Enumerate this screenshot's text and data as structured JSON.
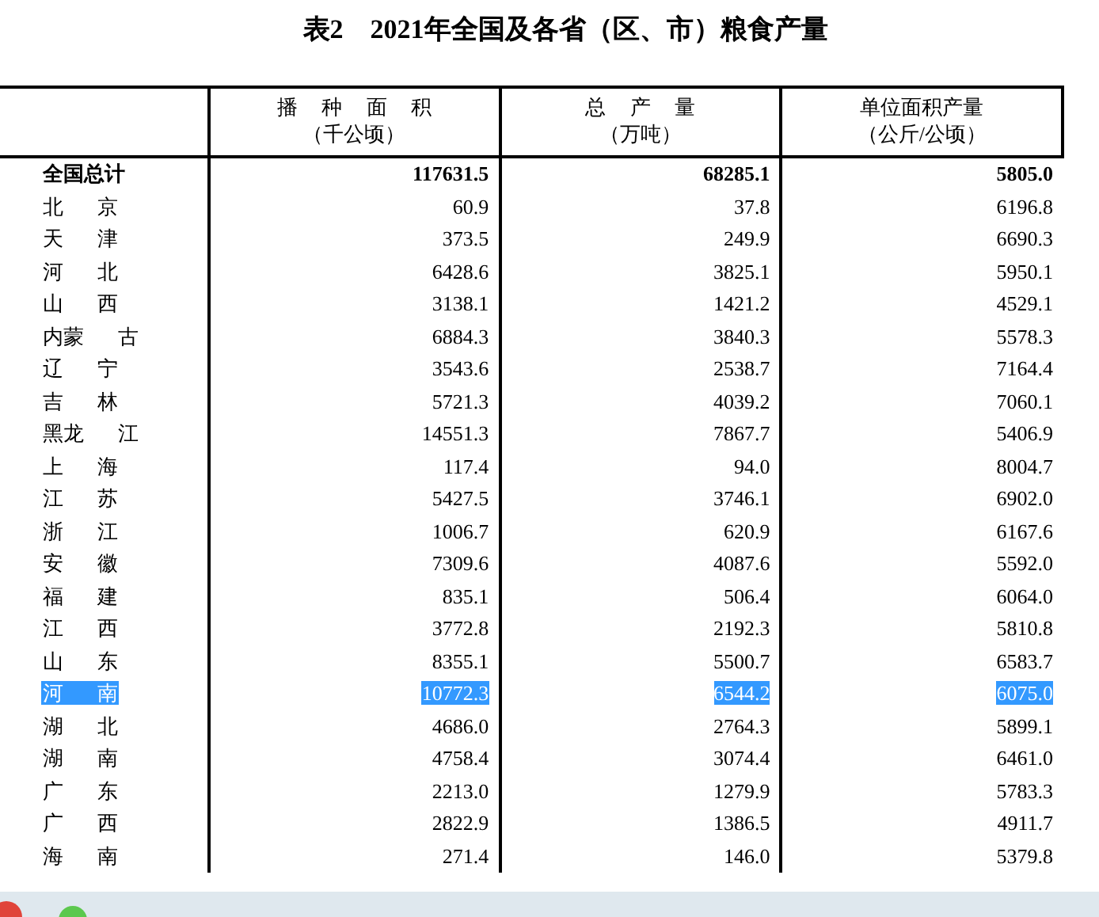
{
  "title": "表2　2021年全国及各省（区、市）粮食产量",
  "columns": [
    {
      "label": "播 种 面 积",
      "unit": "（千公顷）"
    },
    {
      "label": "总 产 量",
      "unit": "（万吨）"
    },
    {
      "label": "单位面积产量",
      "unit": "（公斤/公顷）"
    }
  ],
  "total": {
    "name": "全国总计",
    "values": [
      "117631.5",
      "68285.1",
      "5805.0"
    ]
  },
  "rows": [
    {
      "name": "北 京",
      "values": [
        "60.9",
        "37.8",
        "6196.8"
      ],
      "selected": false
    },
    {
      "name": "天 津",
      "values": [
        "373.5",
        "249.9",
        "6690.3"
      ],
      "selected": false
    },
    {
      "name": "河 北",
      "values": [
        "6428.6",
        "3825.1",
        "5950.1"
      ],
      "selected": false
    },
    {
      "name": "山 西",
      "values": [
        "3138.1",
        "1421.2",
        "4529.1"
      ],
      "selected": false
    },
    {
      "name": "内蒙 古",
      "values": [
        "6884.3",
        "3840.3",
        "5578.3"
      ],
      "selected": false
    },
    {
      "name": "辽 宁",
      "values": [
        "3543.6",
        "2538.7",
        "7164.4"
      ],
      "selected": false
    },
    {
      "name": "吉 林",
      "values": [
        "5721.3",
        "4039.2",
        "7060.1"
      ],
      "selected": false
    },
    {
      "name": "黑龙 江",
      "values": [
        "14551.3",
        "7867.7",
        "5406.9"
      ],
      "selected": false
    },
    {
      "name": "上 海",
      "values": [
        "117.4",
        "94.0",
        "8004.7"
      ],
      "selected": false
    },
    {
      "name": "江 苏",
      "values": [
        "5427.5",
        "3746.1",
        "6902.0"
      ],
      "selected": false
    },
    {
      "name": "浙 江",
      "values": [
        "1006.7",
        "620.9",
        "6167.6"
      ],
      "selected": false
    },
    {
      "name": "安 徽",
      "values": [
        "7309.6",
        "4087.6",
        "5592.0"
      ],
      "selected": false
    },
    {
      "name": "福 建",
      "values": [
        "835.1",
        "506.4",
        "6064.0"
      ],
      "selected": false
    },
    {
      "name": "江 西",
      "values": [
        "3772.8",
        "2192.3",
        "5810.8"
      ],
      "selected": false
    },
    {
      "name": "山 东",
      "values": [
        "8355.1",
        "5500.7",
        "6583.7"
      ],
      "selected": false
    },
    {
      "name": "河 南",
      "values": [
        "10772.3",
        "6544.2",
        "6075.0"
      ],
      "selected": true
    },
    {
      "name": "湖 北",
      "values": [
        "4686.0",
        "2764.3",
        "5899.1"
      ],
      "selected": false
    },
    {
      "name": "湖 南",
      "values": [
        "4758.4",
        "3074.4",
        "6461.0"
      ],
      "selected": false
    },
    {
      "name": "广 东",
      "values": [
        "2213.0",
        "1279.9",
        "5783.3"
      ],
      "selected": false
    },
    {
      "name": "广 西",
      "values": [
        "2822.9",
        "1386.5",
        "4911.7"
      ],
      "selected": false
    },
    {
      "name": "海 南",
      "values": [
        "271.4",
        "146.0",
        "5379.8"
      ],
      "selected": false
    }
  ]
}
